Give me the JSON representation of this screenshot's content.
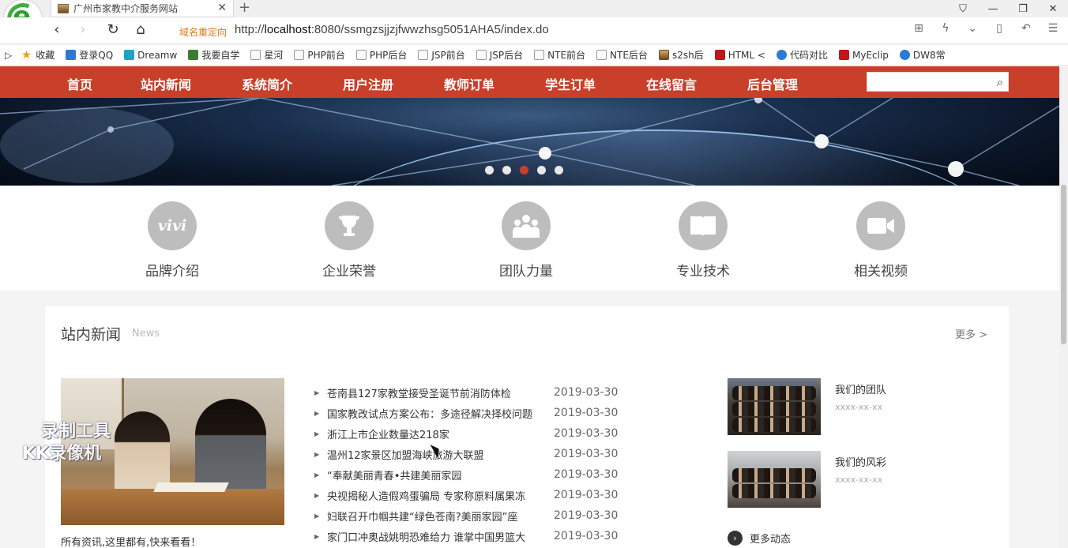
{
  "browser": {
    "tab_title": "广州市家教中介服务网站",
    "redirect_label": "域名重定向",
    "url_prefix": "http://",
    "url_host": "localhost",
    "url_rest": ":8080/ssmgzsjjzjfwwzhsg5051AHA5/index.do",
    "bookmarks": [
      "收藏",
      "登录QQ",
      "Dreamw",
      "我要自学",
      "星河",
      "PHP前台",
      "PHP后台",
      "JSP前台",
      "JSP后台",
      "NTE前台",
      "NTE后台",
      "s2sh后",
      "HTML <",
      "代码对比",
      "MyEclip",
      "DW8常"
    ]
  },
  "nav": {
    "items": [
      "首页",
      "站内新闻",
      "系统简介",
      "用户注册",
      "教师订单",
      "学生订单",
      "在线留言",
      "后台管理"
    ],
    "search_placeholder": ""
  },
  "features": [
    {
      "label": "品牌介绍",
      "icon": "vivi-icon"
    },
    {
      "label": "企业荣誉",
      "icon": "trophy-icon"
    },
    {
      "label": "团队力量",
      "icon": "team-icon"
    },
    {
      "label": "专业技术",
      "icon": "book-icon"
    },
    {
      "label": "相关视频",
      "icon": "video-camera-icon"
    }
  ],
  "news": {
    "title": "站内新闻",
    "subtitle": "News",
    "more": "更多 >",
    "caption": "所有资讯,这里都有,快来看看！",
    "items": [
      {
        "title": "苍南县127家教堂接受圣诞节前消防体检",
        "date": "2019-03-30"
      },
      {
        "title": "国家教改试点方案公布：多途径解决择校问题",
        "date": "2019-03-30"
      },
      {
        "title": "浙江上市企业数量达218家",
        "date": "2019-03-30"
      },
      {
        "title": "温州12家景区加盟海峡旅游大联盟",
        "date": "2019-03-30"
      },
      {
        "title": "“奉献美丽青春•共建美丽家园",
        "date": "2019-03-30"
      },
      {
        "title": "央视揭秘人造假鸡蛋骗局 专家称原料属果冻",
        "date": "2019-03-30"
      },
      {
        "title": "妇联召开巾帼共建“绿色苍南?美丽家园”座",
        "date": "2019-03-30"
      },
      {
        "title": "家门口冲奥战姚明恐难给力 谁掌中国男篮大",
        "date": "2019-03-30"
      }
    ],
    "side": [
      {
        "title": "我们的团队",
        "date": "xxxx-xx-xx"
      },
      {
        "title": "我们的风彩",
        "date": "xxxx-xx-xx"
      }
    ],
    "more_dynamic": "更多动态"
  },
  "watermark": {
    "line1": "录制工具",
    "line2": "KK录像机"
  },
  "colors": {
    "nav_bg": "#c8402a",
    "active_dot": "#c8402a"
  }
}
